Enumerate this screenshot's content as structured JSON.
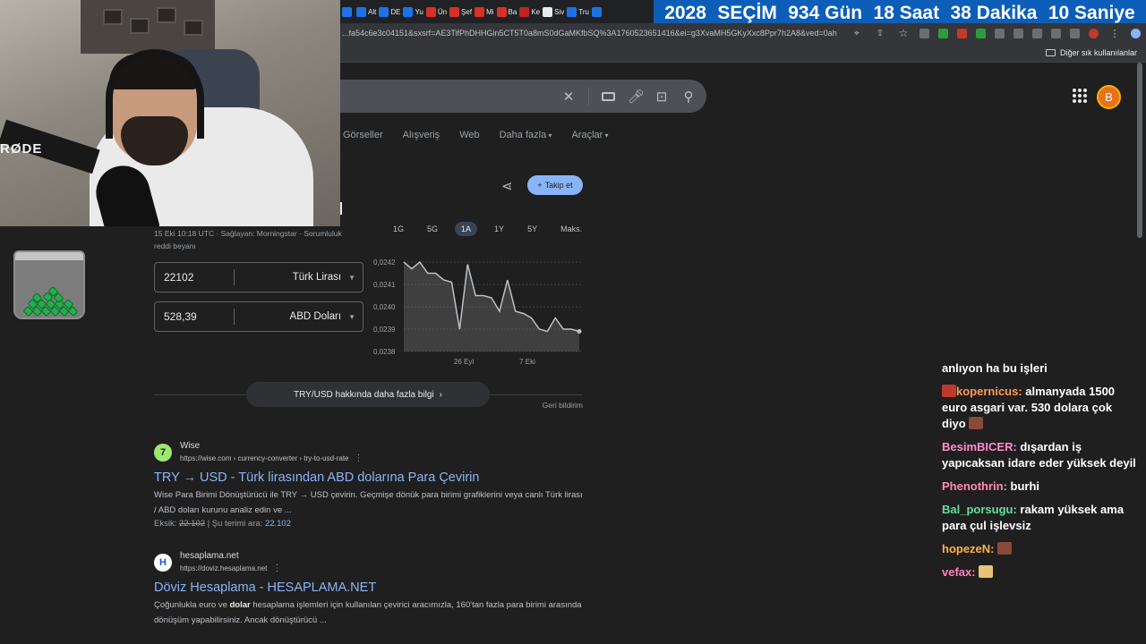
{
  "tabs": [
    {
      "label": "",
      "icon": "news-icon",
      "color": "#1a73e8"
    },
    {
      "label": "Alt",
      "icon": "news-icon",
      "color": "#1a73e8"
    },
    {
      "label": "DE",
      "icon": "news-icon",
      "color": "#1a73e8"
    },
    {
      "label": "Yu",
      "icon": "news-icon",
      "color": "#1a73e8"
    },
    {
      "label": "Ün",
      "icon": "b-icon",
      "color": "#d93025"
    },
    {
      "label": "Şef",
      "icon": "flag-icon",
      "color": "#d93025"
    },
    {
      "label": "Mi",
      "icon": "flag-icon",
      "color": "#d93025"
    },
    {
      "label": "Ba",
      "icon": "flag-icon",
      "color": "#d93025"
    },
    {
      "label": "Ke",
      "icon": "n-icon",
      "color": "#c5221f"
    },
    {
      "label": "Siv",
      "icon": "page-icon",
      "color": "#e8eaed"
    },
    {
      "label": "Tru",
      "icon": "news-icon",
      "color": "#1a73e8"
    },
    {
      "label": "",
      "icon": "news-icon",
      "color": "#1a73e8"
    }
  ],
  "countdown": [
    "2028",
    "SEÇİM",
    "934 Gün",
    "18 Saat",
    "38 Dakika",
    "10 Saniye"
  ],
  "address": {
    "url": "...fa54c6e3c04151&sxsrf=AE3TifPhDHHGin5CT5T0a8mS0dGaMKfbSQ%3A1760523651416&ei=g3XvaMH5GKyXxc8Ppr7h2A8&ved=0ah..."
  },
  "bookmarks": {
    "other": "Diğer sık kullanılanlar"
  },
  "avatar": {
    "letter": "B"
  },
  "nav": [
    "Görseller",
    "Alışveriş",
    "Web",
    "Daha fazla",
    "Araçlar"
  ],
  "follow": {
    "label": "Takip et"
  },
  "ranges": [
    "1G",
    "5G",
    "1A",
    "1Y",
    "5Y",
    "Maks."
  ],
  "source": {
    "line1": "15 Eki 10:18 UTC · Sağlayan: Morningstar · Sorumluluk",
    "line2": "reddi beyanı"
  },
  "converter": {
    "from_value": "22102",
    "from_currency": "Türk Lirası",
    "to_value": "528,39",
    "to_currency": "ABD Doları"
  },
  "chart_data": {
    "type": "line",
    "yticks": [
      "0,0242",
      "0,0241",
      "0,0240",
      "0,0239",
      "0,0238"
    ],
    "xticks": [
      "26 Eyl",
      "7 Eki"
    ],
    "ylim": [
      0.0238,
      0.0242
    ],
    "points": [
      0.0242,
      0.02417,
      0.0242,
      0.02415,
      0.02415,
      0.02412,
      0.02411,
      0.0239,
      0.02419,
      0.02405,
      0.02405,
      0.02404,
      0.02398,
      0.02412,
      0.02398,
      0.02397,
      0.02395,
      0.0239,
      0.02389,
      0.02395,
      0.0239,
      0.0239,
      0.02389
    ],
    "grid": true
  },
  "more_info": {
    "label": "TRY/USD hakkında daha fazla bilgi"
  },
  "feedback": {
    "label": "Geri bildirim"
  },
  "results": [
    {
      "site": "Wise",
      "url": "https://wise.com › currency-converter › try-to-usd-rate",
      "title": "TRY → USD - Türk lirasından ABD dolarına Para Çevirin",
      "snippet": "Wise Para Birimi Dönüştürücü ile TRY → USD çevirin. Geçmişe dönük para birimi grafiklerini veya canlı Türk lirası / ABD doları kurunu analiz edin ve ...",
      "missing_label": "Eksik:",
      "missing_term": "22.102",
      "must_include": "| Şu terimi ara:",
      "must_term": "22.102"
    },
    {
      "site": "hesaplama.net",
      "url": "https://doviz.hesaplama.net",
      "title": "Döviz Hesaplama - HESAPLAMA.NET",
      "snippet_pre": "Çoğunlukla euro ve ",
      "snippet_bold": "dolar",
      "snippet_post": " hesaplama işlemleri için kullanılan çevirici aracımızla, 160'tan fazla para birimi arasında dönüşüm yapabilirsiniz. Ancak dönüştürücü ..."
    }
  ],
  "webcam": {
    "brand": "RØDE"
  },
  "chat": [
    {
      "user": "",
      "text": "anlıyon ha bu işleri",
      "color": "#ffffff"
    },
    {
      "user": "kopernicus:",
      "text": "almanyada 1500 euro asgari var. 530 dolara çok diyo",
      "color": "#ff9a57",
      "badge": true,
      "emote": "#8a4a3a"
    },
    {
      "user": "BesimBICER:",
      "text": "dışardan iş yapıcaksan idare eder yüksek deyil",
      "color": "#ff8cd4"
    },
    {
      "user": "Phenothrin:",
      "text": "burhi",
      "color": "#ff8cb0"
    },
    {
      "user": "Bal_porsugu:",
      "text": "rakam yüksek ama para çul işlevsiz",
      "color": "#5fe0a0"
    },
    {
      "user": "hopezeN:",
      "text": "",
      "color": "#ffb347",
      "emote": "#8a4a3a"
    },
    {
      "user": "vefax:",
      "text": "",
      "color": "#ff80c0",
      "emote": "#e8c27a"
    }
  ]
}
